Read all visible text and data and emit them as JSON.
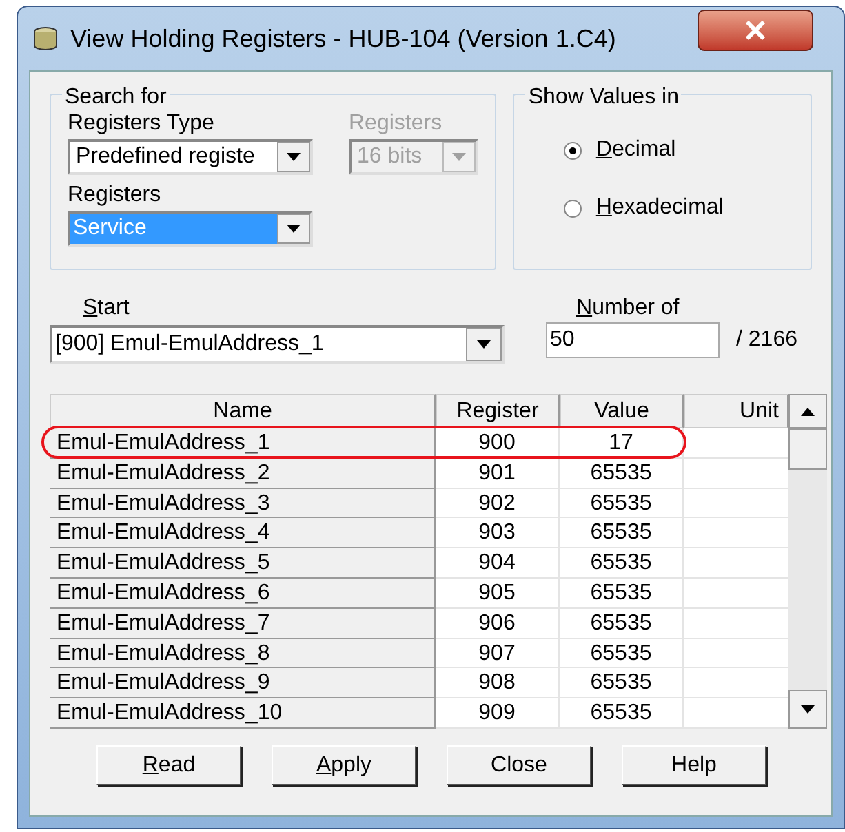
{
  "window": {
    "title": "View Holding Registers - HUB-104 (Version 1.C4)"
  },
  "search_for": {
    "title": "Search for",
    "registers_type": {
      "label": "Registers Type",
      "value": "Predefined registe"
    },
    "registers_size": {
      "label": "Registers",
      "value": "16 bits",
      "disabled": true
    },
    "registers": {
      "label": "Registers",
      "value": "Service",
      "selected": true
    }
  },
  "show_values_in": {
    "title": "Show Values in",
    "options": [
      {
        "label": "Decimal",
        "mnemonic": true,
        "selected": true
      },
      {
        "label": "Hexadecimal",
        "mnemonic": true,
        "selected": false
      }
    ]
  },
  "start": {
    "label": "Start",
    "mnemonic": true,
    "value": "[900] Emul-EmulAddress_1"
  },
  "number_of": {
    "label": "Number of",
    "mnemonic": true,
    "value": "50",
    "total": "/ 2166"
  },
  "table": {
    "columns": [
      "Name",
      "Register",
      "Value",
      "Unit"
    ],
    "rows": [
      {
        "name": "Emul-EmulAddress_1",
        "register": "900",
        "value": "17",
        "highlighted": true
      },
      {
        "name": "Emul-EmulAddress_2",
        "register": "901",
        "value": "65535",
        "highlighted": false
      },
      {
        "name": "Emul-EmulAddress_3",
        "register": "902",
        "value": "65535",
        "highlighted": false
      },
      {
        "name": "Emul-EmulAddress_4",
        "register": "903",
        "value": "65535",
        "highlighted": false
      },
      {
        "name": "Emul-EmulAddress_5",
        "register": "904",
        "value": "65535",
        "highlighted": false
      },
      {
        "name": "Emul-EmulAddress_6",
        "register": "905",
        "value": "65535",
        "highlighted": false
      },
      {
        "name": "Emul-EmulAddress_7",
        "register": "906",
        "value": "65535",
        "highlighted": false
      },
      {
        "name": "Emul-EmulAddress_8",
        "register": "907",
        "value": "65535",
        "highlighted": false
      },
      {
        "name": "Emul-EmulAddress_9",
        "register": "908",
        "value": "65535",
        "highlighted": false
      },
      {
        "name": "Emul-EmulAddress_10",
        "register": "909",
        "value": "65535",
        "highlighted": false
      }
    ]
  },
  "buttons": [
    {
      "label": "Read",
      "mnemonic": true
    },
    {
      "label": "Apply",
      "mnemonic": true
    },
    {
      "label": "Close",
      "mnemonic": false
    },
    {
      "label": "Help",
      "mnemonic": false
    }
  ]
}
